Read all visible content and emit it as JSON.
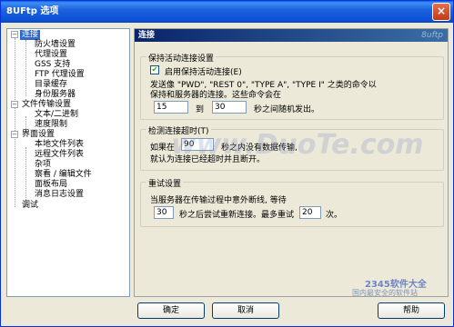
{
  "window": {
    "title": "8UFtp 选项",
    "close_label": "×"
  },
  "tree": {
    "items": [
      {
        "label": "连接",
        "level": 0,
        "expanded": true,
        "selected": true
      },
      {
        "label": "防火墙设置",
        "level": 1
      },
      {
        "label": "代理设置",
        "level": 1
      },
      {
        "label": "GSS 支持",
        "level": 1
      },
      {
        "label": "FTP 代理设置",
        "level": 1
      },
      {
        "label": "目录缓存",
        "level": 1
      },
      {
        "label": "身份服务器",
        "level": 1
      },
      {
        "label": "文件传输设置",
        "level": 0,
        "expanded": true
      },
      {
        "label": "文本/二进制",
        "level": 1
      },
      {
        "label": "速度限制",
        "level": 1
      },
      {
        "label": "界面设置",
        "level": 0,
        "expanded": true
      },
      {
        "label": "本地文件列表",
        "level": 1
      },
      {
        "label": "远程文件列表",
        "level": 1
      },
      {
        "label": "杂项",
        "level": 1
      },
      {
        "label": "察看 / 编辑文件",
        "level": 1
      },
      {
        "label": "面板布局",
        "level": 1
      },
      {
        "label": "消息日志设置",
        "level": 1
      },
      {
        "label": "调试",
        "level": 0
      }
    ]
  },
  "panel": {
    "title": "连接",
    "brand": "8uftp",
    "keepalive": {
      "group_title": "保持活动连接设置",
      "checkbox_label": "启用保持活动连接(E)",
      "checked": true,
      "desc_line1": "发送像 \"PWD\", \"REST 0\", \"TYPE A\", \"TYPE I\" 之类的命令以",
      "desc_line2": "保持和服务器的连接。这些命令会在",
      "from_value": "15",
      "to_label": "到",
      "to_value": "30",
      "suffix": "秒之间随机发出。"
    },
    "timeout": {
      "group_title": "检测连接超时(T)",
      "prefix": "如果在",
      "value": "90",
      "line1_suffix": "秒之内没有数据传输,",
      "line2": "就认为连接已经超时并且断开。"
    },
    "retry": {
      "group_title": "重试设置",
      "line1": "当服务器在传输过程中意外断线, 等待",
      "wait_value": "30",
      "mid": "秒之后尝试重新连接。最多重试",
      "count_value": "20",
      "suffix": "次。"
    }
  },
  "buttons": {
    "ok": "确定",
    "cancel": "取消",
    "help": "帮助"
  },
  "watermarks": {
    "main": "www.DuoTe.com",
    "corner": "2345软件大全",
    "corner_sub": "国内最安全的软件站"
  }
}
